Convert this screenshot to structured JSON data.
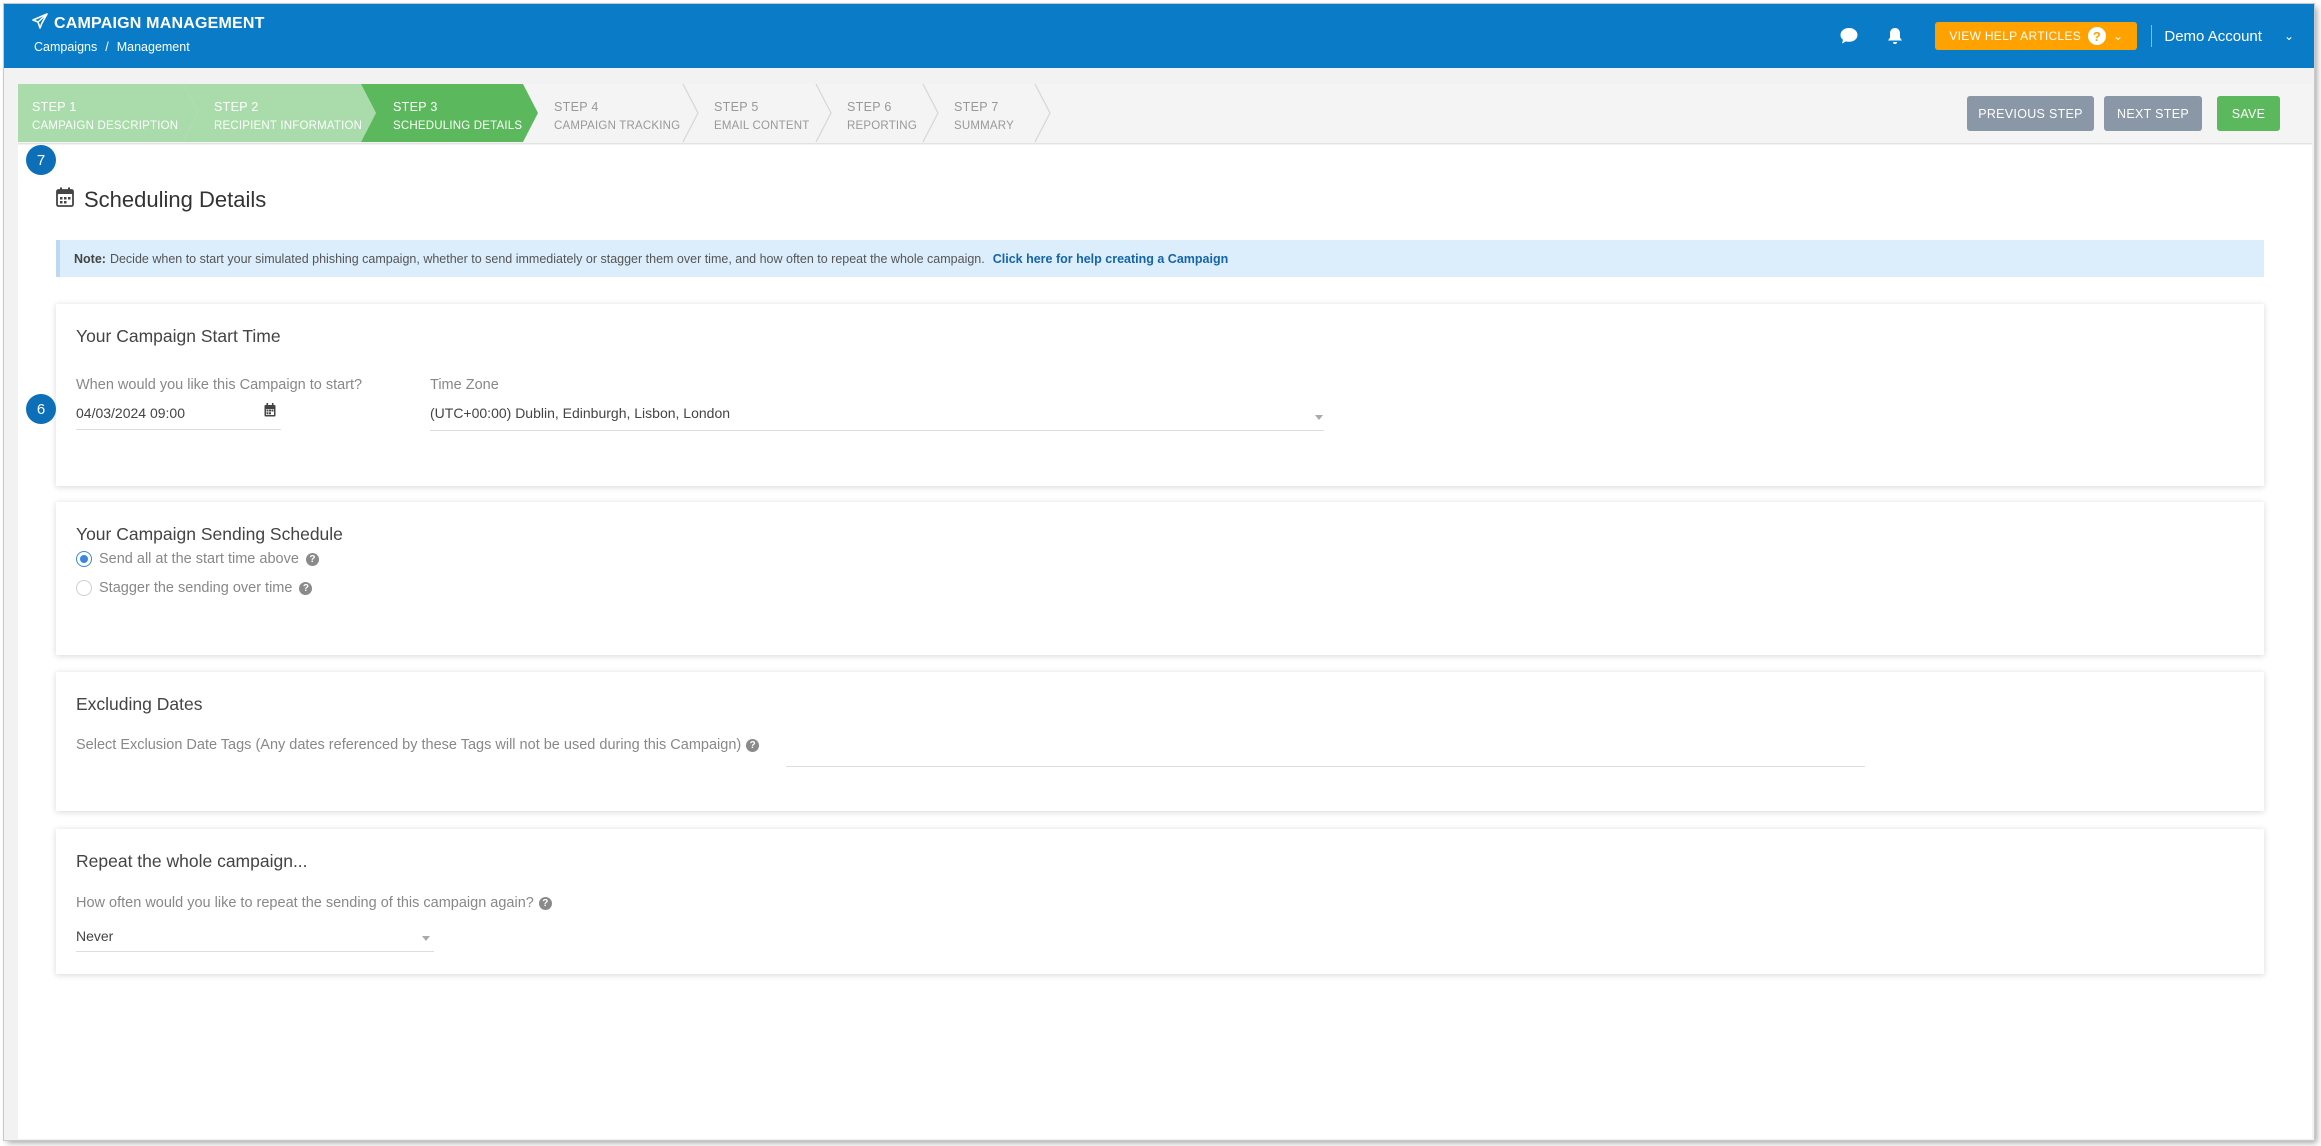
{
  "header": {
    "app_title": "CAMPAIGN MANAGEMENT",
    "breadcrumb": [
      "Campaigns",
      "/",
      "Management"
    ],
    "help_button": "VIEW HELP ARTICLES",
    "help_badge": "?",
    "account_name": "Demo Account",
    "icons": [
      "paper-plane-icon",
      "chat-icon",
      "bell-icon",
      "chevron-down-icon"
    ]
  },
  "steps": [
    {
      "num": "STEP 1",
      "name": "CAMPAIGN DESCRIPTION",
      "state": "completed"
    },
    {
      "num": "STEP 2",
      "name": "RECIPIENT INFORMATION",
      "state": "completed"
    },
    {
      "num": "STEP 3",
      "name": "SCHEDULING DETAILS",
      "state": "active"
    },
    {
      "num": "STEP 4",
      "name": "CAMPAIGN TRACKING",
      "state": "pending"
    },
    {
      "num": "STEP 5",
      "name": "EMAIL CONTENT",
      "state": "pending"
    },
    {
      "num": "STEP 6",
      "name": "REPORTING",
      "state": "pending"
    },
    {
      "num": "STEP 7",
      "name": "SUMMARY",
      "state": "pending"
    }
  ],
  "nav_buttons": {
    "previous": "PREVIOUS STEP",
    "next": "NEXT STEP",
    "save": "SAVE"
  },
  "page": {
    "title": "Scheduling Details",
    "note_label": "Note:",
    "note_text": "Decide when to start your simulated phishing campaign, whether to send immediately or stagger them over time, and how often to repeat the whole campaign.",
    "note_link": "Click here for help creating a Campaign"
  },
  "start_time": {
    "title": "Your Campaign Start Time",
    "start_label": "When would you like this Campaign to start?",
    "start_value": "04/03/2024 09:00",
    "timezone_label": "Time Zone",
    "timezone_value": "(UTC+00:00) Dublin, Edinburgh, Lisbon, London",
    "callout": "6"
  },
  "sending_schedule": {
    "title": "Your Campaign Sending Schedule",
    "options": [
      {
        "label": "Send all at the start time above",
        "selected": true
      },
      {
        "label": "Stagger the sending over time",
        "selected": false
      }
    ],
    "callout": "7"
  },
  "excluding_dates": {
    "title": "Excluding Dates",
    "label": "Select Exclusion Date Tags (Any dates referenced by these Tags will not be used during this Campaign)",
    "value": ""
  },
  "repeat": {
    "title": "Repeat the whole campaign...",
    "label": "How often would you like to repeat the sending of this campaign again?",
    "value": "Never"
  },
  "colors": {
    "topbar": "#0a7cc7",
    "step_completed": "#a9dcaa",
    "step_active": "#5cb85c",
    "step_pending": "#f4f4f4",
    "nav_button": "#8a97a7",
    "save_button": "#5cb85c",
    "help_button": "#ffa200",
    "note_bg": "#dcedfb",
    "callout": "#0d6fb8"
  }
}
